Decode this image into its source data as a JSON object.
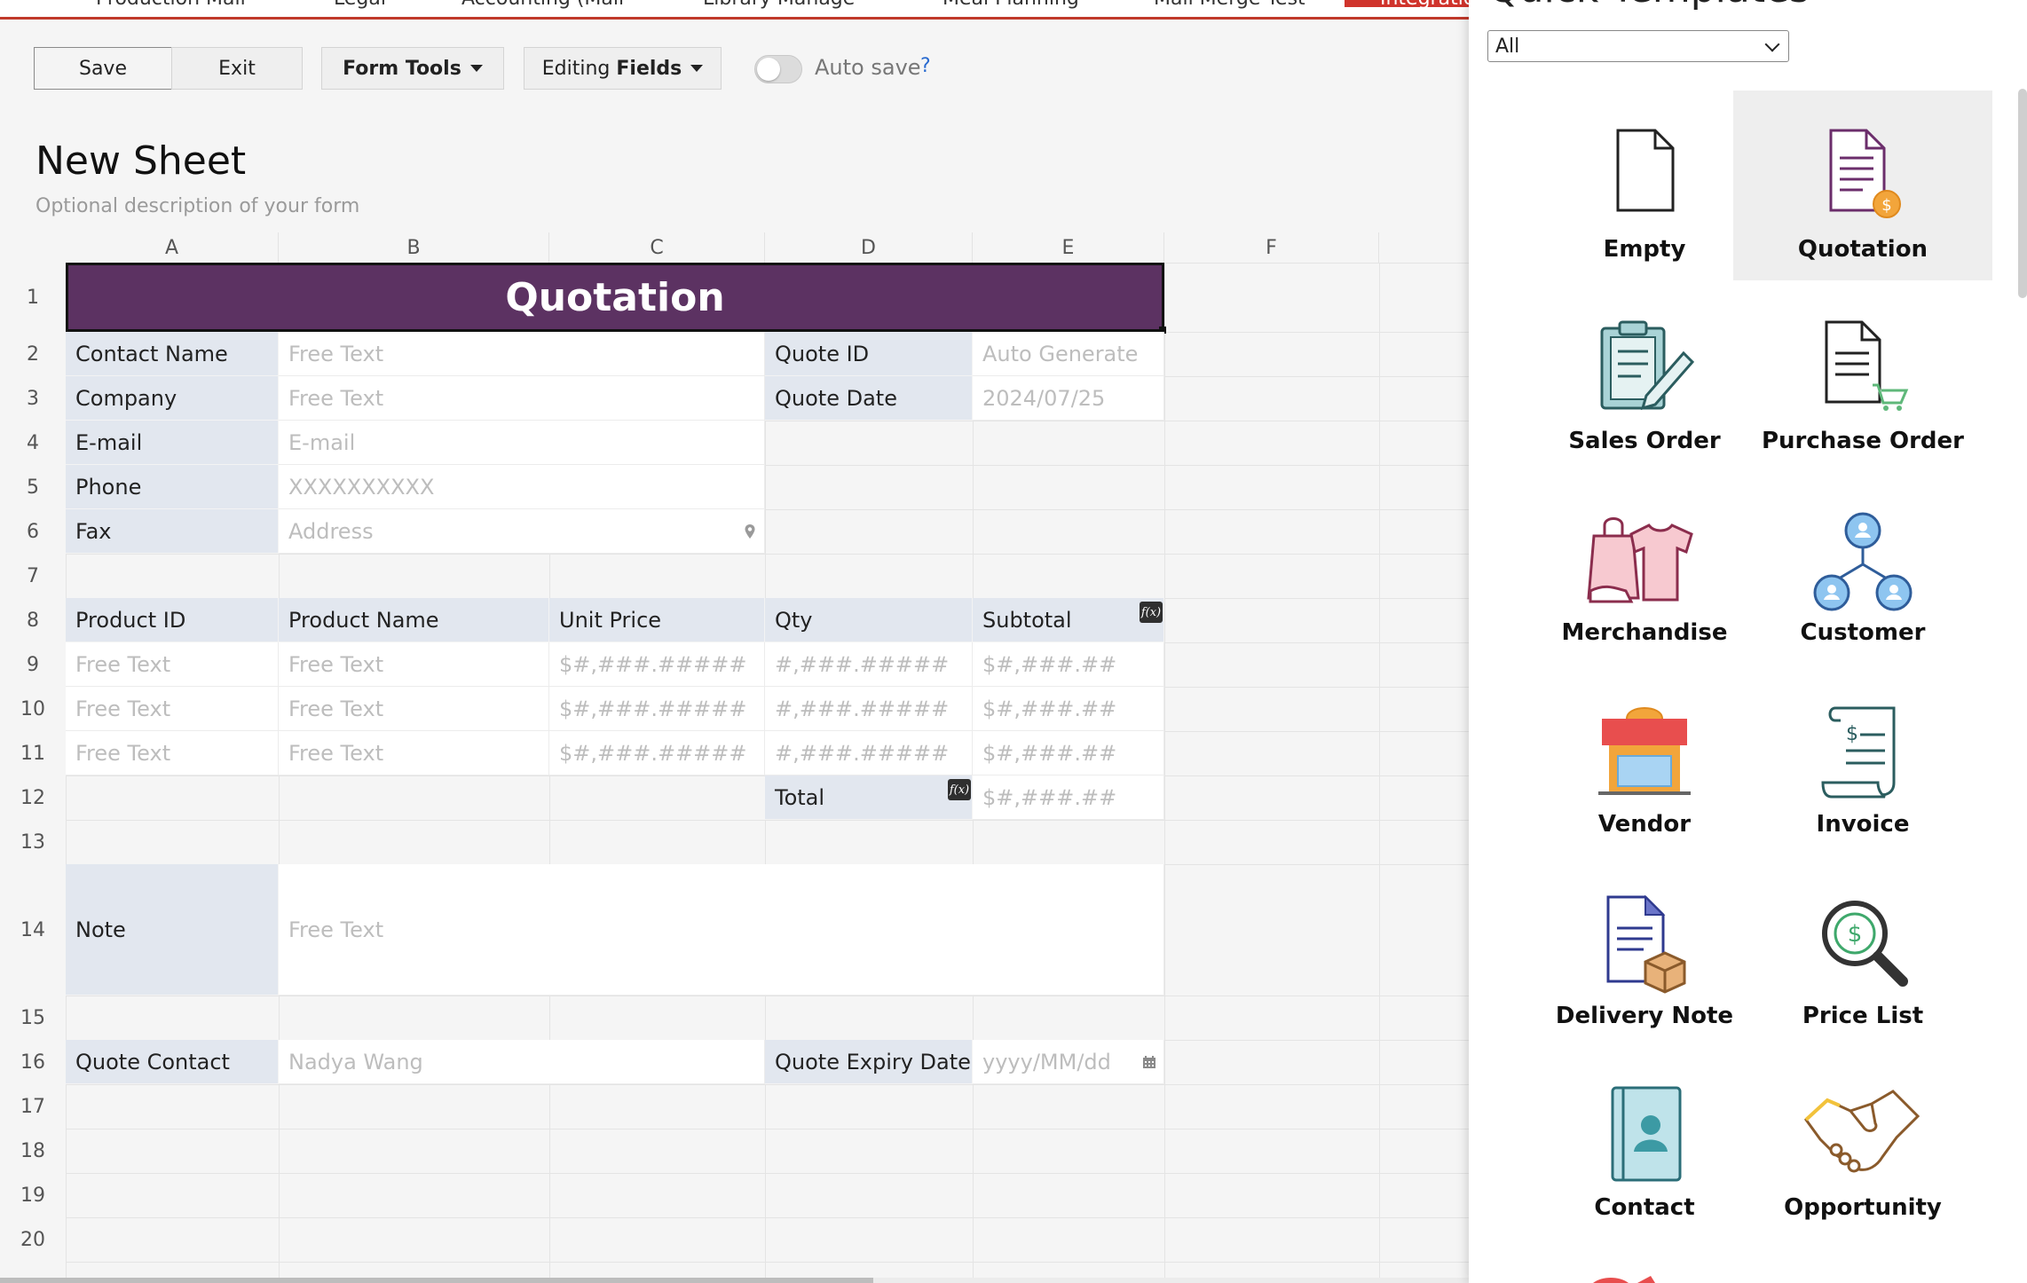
{
  "tabs": [
    "Production Mail",
    "Legal",
    "Accounting (Mail",
    "Library Manage",
    "Meal Planning",
    "Mail Merge Test",
    "Integration Test"
  ],
  "toolbar": {
    "save": "Save",
    "exit": "Exit",
    "form_tools": "Form Tools",
    "editing_prefix": "Editing",
    "editing_bold": "Fields",
    "autosave": "Auto save",
    "help": "?"
  },
  "form": {
    "title": "New Sheet",
    "description": "Optional description of your form"
  },
  "columns": [
    "A",
    "B",
    "C",
    "D",
    "E",
    "F"
  ],
  "rows": [
    "1",
    "2",
    "3",
    "4",
    "5",
    "6",
    "7",
    "8",
    "9",
    "10",
    "11",
    "12",
    "13",
    "14",
    "15",
    "16",
    "17",
    "18",
    "19",
    "20"
  ],
  "sheet": {
    "title": "Quotation",
    "contact_name": "Contact Name",
    "company": "Company",
    "email": "E-mail",
    "phone": "Phone",
    "fax": "Fax",
    "quote_id": "Quote ID",
    "quote_date": "Quote Date",
    "free_text": "Free Text",
    "email_ph": "E-mail",
    "phone_ph": "XXXXXXXXXX",
    "address_ph": "Address",
    "auto_generate": "Auto Generate",
    "date_value": "2024/07/25",
    "headers": [
      "Product ID",
      "Product Name",
      "Unit Price",
      "Qty",
      "Subtotal"
    ],
    "item_rows": [
      [
        "Free Text",
        "Free Text",
        "$#,###.#####",
        "#,###.#####",
        "$#,###.##"
      ],
      [
        "Free Text",
        "Free Text",
        "$#,###.#####",
        "#,###.#####",
        "$#,###.##"
      ],
      [
        "Free Text",
        "Free Text",
        "$#,###.#####",
        "#,###.#####",
        "$#,###.##"
      ]
    ],
    "total": "Total",
    "total_fmt": "$#,###.##",
    "note": "Note",
    "quote_contact": "Quote Contact",
    "quote_contact_value": "Nadya Wang",
    "expiry": "Quote Expiry Date",
    "expiry_ph": "yyyy/MM/dd",
    "fx": "f(x)"
  },
  "panel": {
    "title": "Quick Templates",
    "filter": "All",
    "templates": [
      "Empty",
      "Quotation",
      "Sales Order",
      "Purchase Order",
      "Merchandise",
      "Customer",
      "Vendor",
      "Invoice",
      "Delivery Note",
      "Price List",
      "Contact",
      "Opportunity"
    ],
    "icons": [
      "blank-page-icon",
      "quotation-icon",
      "sales-order-icon",
      "purchase-order-icon",
      "merchandise-icon",
      "customer-icon",
      "vendor-icon",
      "invoice-icon",
      "delivery-note-icon",
      "price-list-icon",
      "contact-icon",
      "opportunity-icon"
    ]
  },
  "colors": {
    "title_bg": "#5c3262",
    "label_bg": "#e2e7ef",
    "active_tab": "#d0342c"
  }
}
